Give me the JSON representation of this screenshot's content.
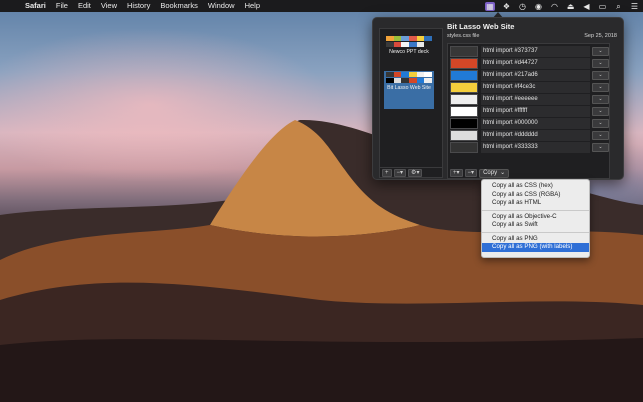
{
  "menubar": {
    "app_name": "Safari",
    "items": [
      "File",
      "Edit",
      "View",
      "History",
      "Bookmarks",
      "Window",
      "Help"
    ],
    "status_icons": [
      "lasso-app-icon",
      "dropbox-icon",
      "time-machine-icon",
      "eye-icon",
      "wifi-icon",
      "eject-icon",
      "volume-icon",
      "airplay-icon",
      "spotlight-icon",
      "notification-center-icon"
    ]
  },
  "sidebar": {
    "documents": [
      {
        "name": "Newco PPT deck",
        "selected": false,
        "swatches": [
          "#f2a33a",
          "#9bbf3b",
          "#6a9cd6",
          "#e05a4a",
          "#f4ce3c",
          "#2f6fb8",
          "#3a3a3a",
          "#d84a3c",
          "#f5f5f5",
          "#3b78c8",
          "#e8e8e8",
          "#1f1f1f"
        ]
      },
      {
        "name": "Bit Lasso Web Site",
        "selected": true,
        "swatches": [
          "#373737",
          "#d44727",
          "#217ad6",
          "#f4ce3c",
          "#eeeeee",
          "#ffffff",
          "#000000",
          "#dddddd",
          "#333333",
          "#d44727",
          "#217ad6",
          "#eeeeee"
        ]
      }
    ],
    "toolbar": {
      "add": "+",
      "remove": "−",
      "remove_arrow": "▾",
      "settings_arrow": "▾"
    }
  },
  "palette": {
    "title": "Bit Lasso Web Site",
    "file": "styles.css file",
    "date": "Sep 25, 2018",
    "colors": [
      {
        "hex": "#373737",
        "label": "html import #373737"
      },
      {
        "hex": "#d44727",
        "label": "html import #d44727"
      },
      {
        "hex": "#217ad6",
        "label": "html import #217ad6"
      },
      {
        "hex": "#f4ce3c",
        "label": "html import #f4ce3c"
      },
      {
        "hex": "#eeeeee",
        "label": "html import #eeeeee"
      },
      {
        "hex": "#ffffff",
        "label": "html import #ffffff"
      },
      {
        "hex": "#000000",
        "label": "html import #000000"
      },
      {
        "hex": "#dddddd",
        "label": "html import #dddddd"
      },
      {
        "hex": "#333333",
        "label": "html import #333333"
      }
    ],
    "toolbar": {
      "add": "+",
      "add_arrow": "▾",
      "remove": "−",
      "remove_arrow": "▾",
      "copy_label": "Copy",
      "copy_arrow": "⌄"
    }
  },
  "copy_menu": {
    "groups": [
      [
        "Copy all as CSS (hex)",
        "Copy all as CSS (RGBA)",
        "Copy all as HTML"
      ],
      [
        "Copy all as Objective-C",
        "Copy all as Swift"
      ],
      [
        "Copy all as PNG",
        "Copy all as PNG (with labels)"
      ]
    ],
    "highlighted": "Copy all as PNG (with labels)"
  },
  "colors": {
    "menu_highlight": "#2f6fd6",
    "selected_doc": "#3a6ea5",
    "status_icon_active": "#7c5fc7"
  }
}
